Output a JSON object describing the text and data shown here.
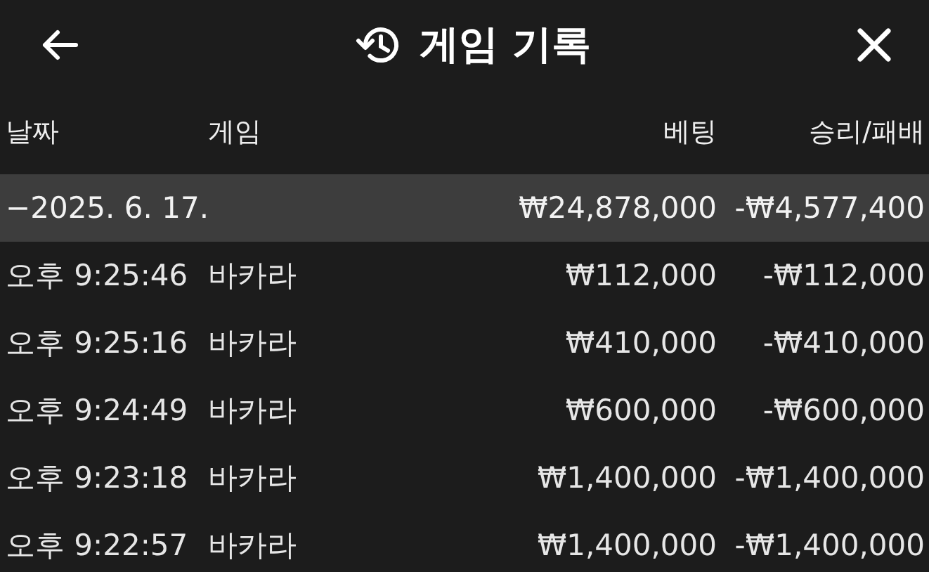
{
  "header": {
    "title": "게임 기록"
  },
  "table": {
    "columns": [
      "날짜",
      "게임",
      "베팅",
      "승리/패배"
    ],
    "rows": [
      {
        "kind": "group",
        "date": "−2025. 6. 17.",
        "bet": "₩24,878,000",
        "result": "-₩4,577,400"
      },
      {
        "kind": "entry",
        "time": "오후 9:25:46",
        "game": "바카라",
        "bet": "₩112,000",
        "result": "-₩112,000"
      },
      {
        "kind": "entry",
        "time": "오후 9:25:16",
        "game": "바카라",
        "bet": "₩410,000",
        "result": "-₩410,000"
      },
      {
        "kind": "entry",
        "time": "오후 9:24:49",
        "game": "바카라",
        "bet": "₩600,000",
        "result": "-₩600,000"
      },
      {
        "kind": "entry",
        "time": "오후 9:23:18",
        "game": "바카라",
        "bet": "₩1,400,000",
        "result": "-₩1,400,000"
      },
      {
        "kind": "entry",
        "time": "오후 9:22:57",
        "game": "바카라",
        "bet": "₩1,400,000",
        "result": "-₩1,400,000"
      }
    ]
  }
}
